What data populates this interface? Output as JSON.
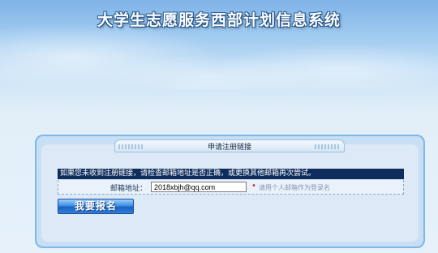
{
  "header": {
    "title": "大学生志愿服务西部计划信息系统"
  },
  "panel": {
    "tab_title": "申请注册链接",
    "notice": "如果您未收到注册链接，请检查邮箱地址是否正确，或更换其他邮箱再次尝试。",
    "email_label": "邮箱地址：",
    "email_value": "2018xbjh@qq.com",
    "required_mark": "•",
    "hint": "请用个人邮箱作为登录名",
    "submit_label": "我要报名"
  },
  "colors": {
    "notice_bg": "#0e2d5c",
    "required": "#e02020",
    "button": "#2f7fdc"
  }
}
